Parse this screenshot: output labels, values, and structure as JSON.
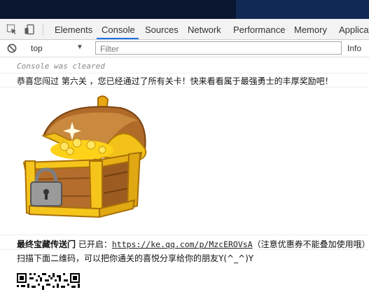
{
  "devtools": {
    "tabs": [
      {
        "label": "Elements",
        "active": false
      },
      {
        "label": "Console",
        "active": true
      },
      {
        "label": "Sources",
        "active": false
      },
      {
        "label": "Network",
        "active": false
      },
      {
        "label": "Performance",
        "active": false
      },
      {
        "label": "Memory",
        "active": false
      },
      {
        "label": "Applicat",
        "active": false
      }
    ],
    "icons": [
      "inspect-element-icon",
      "device-toggle-icon",
      "clear-console-icon"
    ],
    "accent_color": "#1a73e8"
  },
  "filterbar": {
    "context": "top",
    "filter_placeholder": "Filter",
    "filter_value": "",
    "level": "Info"
  },
  "console": {
    "cleared": "Console was cleared",
    "congrats": "恭喜您闯过 第六关 ，您已经通过了所有关卡！快来看看属于最强勇士的丰厚奖励吧！",
    "portal_bold": "最终宝藏传送门",
    "portal_mid": " 已开启：",
    "portal_url": "https://ke.qq.com/p/MzcEROVsA",
    "portal_note": "（注意优惠券不能叠加使用哦）",
    "share": "扫描下面二维码，可以把你通关的喜悦分享给你的朋友Y(^_^)Y",
    "image_names": [
      "treasure-chest-image",
      "qr-code-image"
    ]
  }
}
